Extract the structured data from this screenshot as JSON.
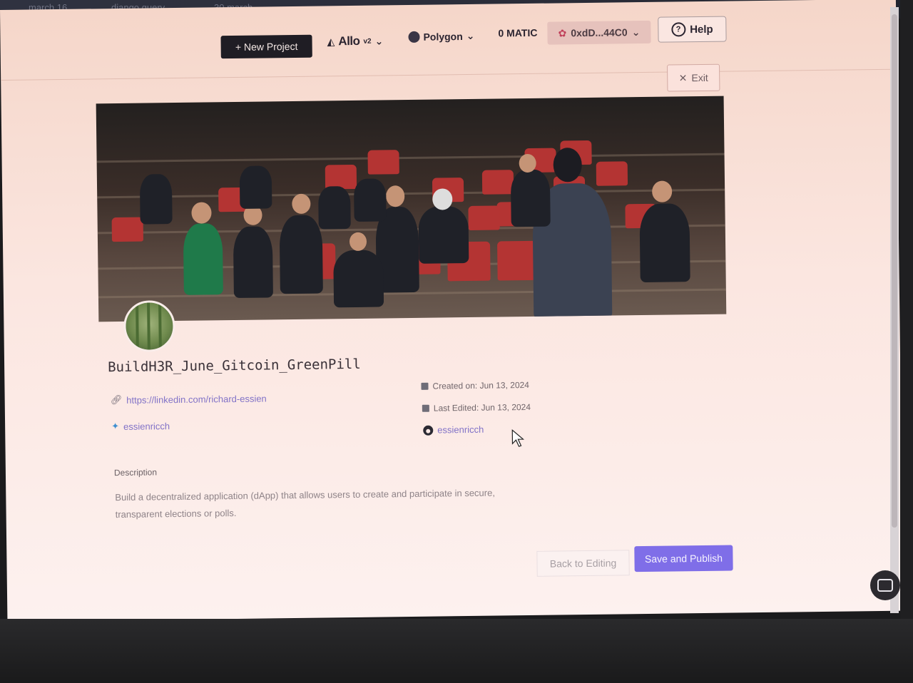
{
  "os_tabs": [
    "march 16",
    "django query",
    "30 march"
  ],
  "header": {
    "new_project_label": "+ New Project",
    "allo_label": "Allo",
    "allo_version": "v2",
    "network_label": "Polygon",
    "balance_label": "0 MATIC",
    "wallet_label": "0xdD...44C0",
    "help_label": "Help"
  },
  "exit_label": "Exit",
  "project": {
    "title": "BuildH3R_June_Gitcoin_GreenPill",
    "website": "https://linkedin.com/richard-essien",
    "twitter": "essienricch",
    "created": "Created on: Jun 13, 2024",
    "edited": "Last Edited: Jun 13, 2024",
    "github": "essienricch",
    "description_label": "Description",
    "description": "Build a decentralized application (dApp) that allows users to create and participate in secure, transparent elections or polls."
  },
  "actions": {
    "back_label": "Back to Editing",
    "publish_label": "Save and Publish"
  }
}
